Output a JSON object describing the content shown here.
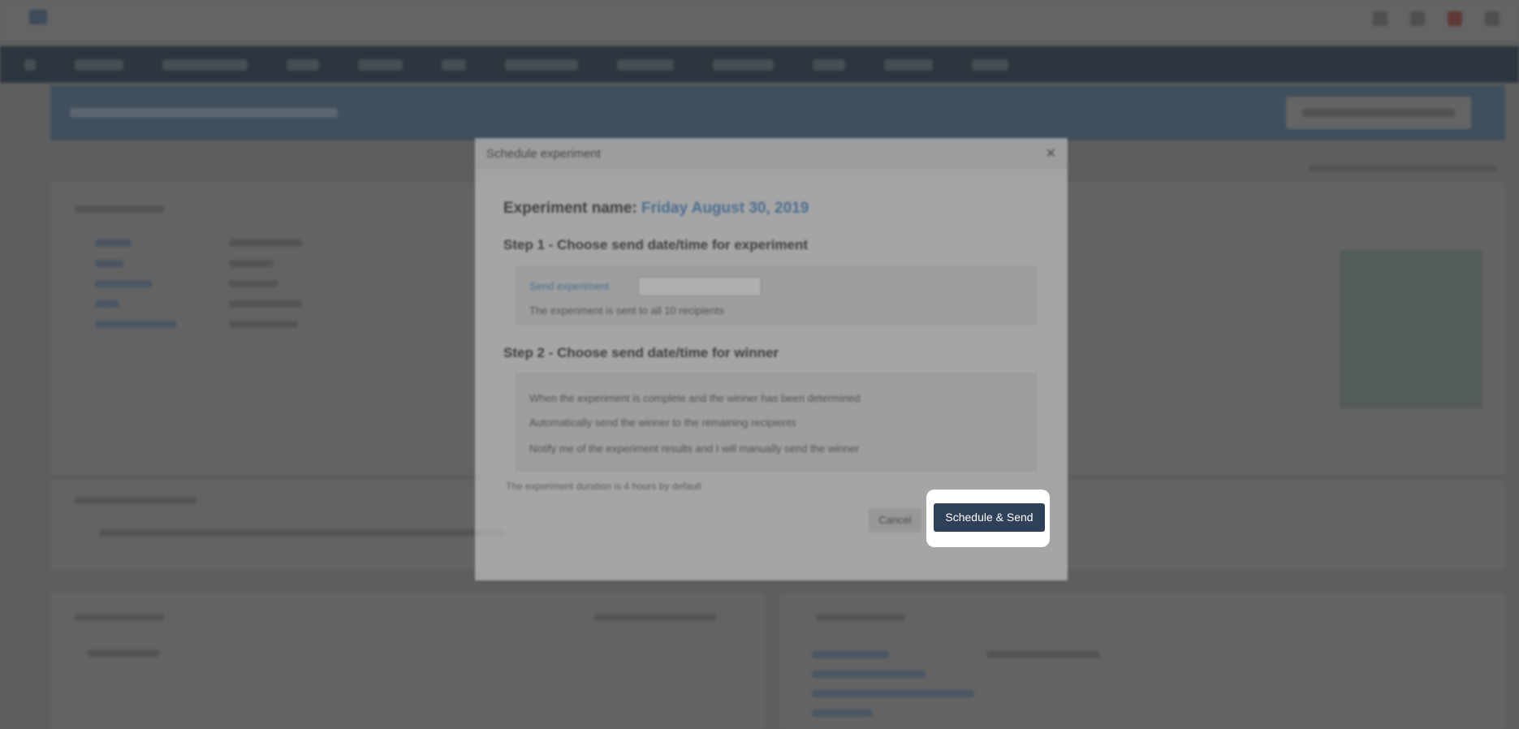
{
  "modal": {
    "title": "Schedule experiment",
    "close_glyph": "✕",
    "experiment_name_label": "Experiment name:",
    "experiment_name_value": "Friday August 30, 2019",
    "step1_heading": "Step 1 - Choose send date/time for experiment",
    "step1_send_label": "Send experiment",
    "step1_note": "The experiment is sent to all 10 recipients",
    "step2_heading": "Step 2 - Choose send date/time for winner",
    "step2_line1": "When the experiment is complete and the winner has been determined",
    "step2_option1": "Automatically send the winner to the remaining recipients",
    "step2_option2": "Notify me of the experiment results and I will manually send the winner",
    "footnote": "The experiment duration is 4 hours by default",
    "cancel_label": "Cancel",
    "primary_label": "Schedule & Send"
  },
  "colors": {
    "primary": "#2f4159",
    "navbar": "#5a6c7e",
    "banner": "#7e9fb9",
    "link": "#3a78b5"
  }
}
